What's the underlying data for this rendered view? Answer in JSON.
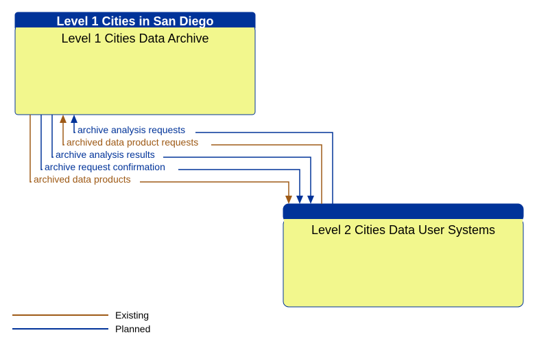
{
  "box1": {
    "header": "Level 1 Cities in San Diego",
    "body": "Level 1 Cities Data Archive"
  },
  "box2": {
    "header": "",
    "body": "Level 2 Cities Data User Systems"
  },
  "flows": {
    "f1": {
      "label": "archive analysis requests",
      "status": "planned",
      "direction": "to_box1"
    },
    "f2": {
      "label": "archived data product requests",
      "status": "existing",
      "direction": "to_box1"
    },
    "f3": {
      "label": "archive analysis results",
      "status": "planned",
      "direction": "to_box2"
    },
    "f4": {
      "label": "archive request confirmation",
      "status": "planned",
      "direction": "to_box2"
    },
    "f5": {
      "label": "archived data products",
      "status": "existing",
      "direction": "to_box2"
    }
  },
  "legend": {
    "existing": "Existing",
    "planned": "Planned"
  },
  "chart_data": {
    "type": "diagram",
    "nodes": [
      {
        "id": "n1",
        "header": "Level 1 Cities in San Diego",
        "body": "Level 1 Cities Data Archive"
      },
      {
        "id": "n2",
        "header": "",
        "body": "Level 2 Cities Data User Systems"
      }
    ],
    "edges": [
      {
        "from": "n2",
        "to": "n1",
        "label": "archive analysis requests",
        "status": "planned"
      },
      {
        "from": "n2",
        "to": "n1",
        "label": "archived data product requests",
        "status": "existing"
      },
      {
        "from": "n1",
        "to": "n2",
        "label": "archive analysis results",
        "status": "planned"
      },
      {
        "from": "n1",
        "to": "n2",
        "label": "archive request confirmation",
        "status": "planned"
      },
      {
        "from": "n1",
        "to": "n2",
        "label": "archived data products",
        "status": "existing"
      }
    ],
    "legend": {
      "existing_color": "#9e5a16",
      "planned_color": "#003399"
    }
  }
}
